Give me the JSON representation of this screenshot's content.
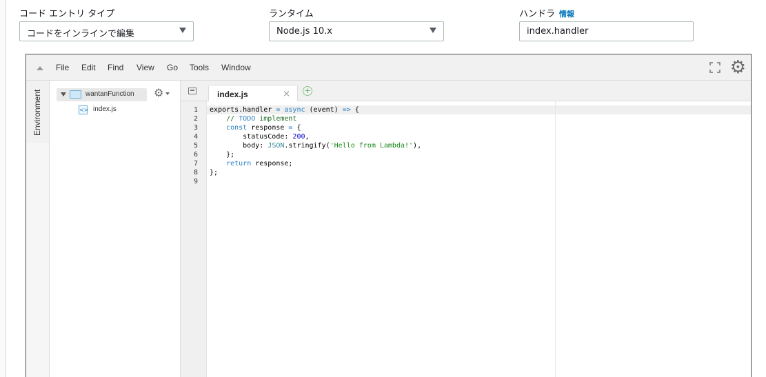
{
  "form": {
    "code_entry": {
      "label": "コード エントリ タイプ",
      "value": "コードをインラインで編集"
    },
    "runtime": {
      "label": "ランタイム",
      "value": "Node.js 10.x"
    },
    "handler": {
      "label": "ハンドラ",
      "info": "情報",
      "value": "index.handler"
    }
  },
  "ide": {
    "menu": [
      "File",
      "Edit",
      "Find",
      "View",
      "Go",
      "Tools",
      "Window"
    ],
    "env_tab": "Environment",
    "tree": {
      "root": "wantanFunction",
      "file": "index.js"
    },
    "tab": {
      "label": "index.js",
      "close": "×"
    },
    "line_numbers": [
      "1",
      "2",
      "3",
      "4",
      "5",
      "6",
      "7",
      "8",
      "9"
    ]
  }
}
